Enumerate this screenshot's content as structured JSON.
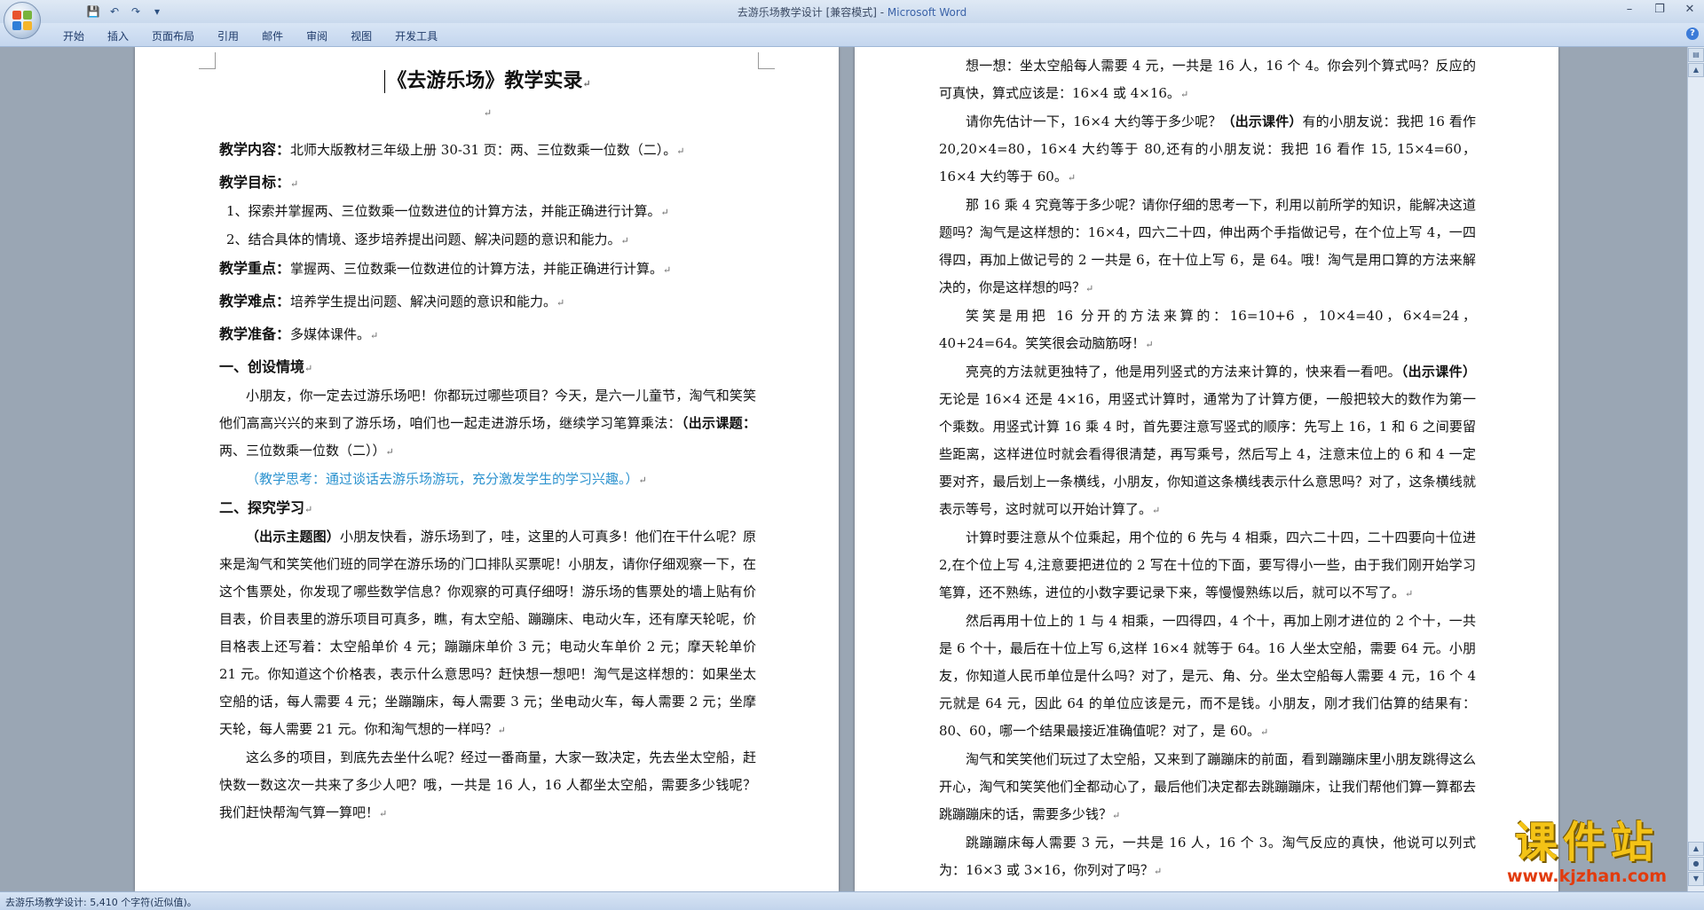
{
  "window": {
    "title": "去游乐场教学设计 [兼容模式] - ",
    "app": "Microsoft Word"
  },
  "qat": {
    "save": "💾",
    "undo": "↶",
    "redo": "↷",
    "more": "▾"
  },
  "ribbon_tabs": [
    "开始",
    "插入",
    "页面布局",
    "引用",
    "邮件",
    "审阅",
    "视图",
    "开发工具"
  ],
  "left_page": {
    "title": "《去游乐场》教学实录",
    "content_label": "教学内容：",
    "content_text": "北师大版教材三年级上册 30-31 页：两、三位数乘一位数（二）。",
    "goals_label": "教学目标：",
    "goals": [
      "1、探索并掌握两、三位数乘一位数进位的计算方法，并能正确进行计算。",
      "2、结合具体的情境、逐步培养提出问题、解决问题的意识和能力。"
    ],
    "key_label": "教学重点：",
    "key_text": "掌握两、三位数乘一位数进位的计算方法，并能正确进行计算。",
    "difficulty_label": "教学难点：",
    "difficulty_text": "培养学生提出问题、解决问题的意识和能力。",
    "prep_label": "教学准备：",
    "prep_text": "多媒体课件。",
    "section1": "一、创设情境",
    "s1_p1": "小朋友，你一定去过游乐场吧！你都玩过哪些项目？今天，是六一儿童节，淘气和笑笑他们高高兴兴的来到了游乐场，咱们也一起走进游乐场，继续学习笔算乘法：",
    "s1_p1_bold": "（出示课题：",
    "s1_p1_end": "两、三位数乘一位数（二））",
    "s1_note": "（教学思考：通过谈话去游乐场游玩，充分激发学生的学习兴趣。）",
    "section2": "二、探究学习",
    "s2_p1_bold": "（出示主题图）",
    "s2_p1": "小朋友快看，游乐场到了，哇，这里的人可真多！他们在干什么呢？原来是淘气和笑笑他们班的同学在游乐场的门口排队买票呢！小朋友，请你仔细观察一下，在这个售票处，你发现了哪些数学信息？你观察的可真仔细呀！游乐场的售票处的墙上贴有价目表，价目表里的游乐项目可真多，瞧，有太空船、蹦蹦床、电动火车，还有摩天轮呢，价目格表上还写着：太空船单价 4 元；蹦蹦床单价 3 元；电动火车单价 2 元；摩天轮单价 21 元。你知道这个价格表，表示什么意思吗？赶快想一想吧！淘气是这样想的：如果坐太空船的话，每人需要 4 元；坐蹦蹦床，每人需要 3 元；坐电动火车，每人需要 2 元；坐摩天轮，每人需要 21 元。你和淘气想的一样吗？",
    "s2_p2": "这么多的项目，到底先去坐什么呢？经过一番商量，大家一致决定，先去坐太空船，赶快数一数这次一共来了多少人吧？哦，一共是 16 人，16 人都坐太空船，需要多少钱呢？我们赶快帮淘气算一算吧！"
  },
  "right_page": {
    "p1": "想一想：坐太空船每人需要 4 元，一共是 16 人，16 个 4。你会列个算式吗？反应的可真快，算式应该是：16×4 或 4×16。",
    "p2a": "请你先估计一下，16×4 大约等于多少呢？",
    "p2b": "（出示课件）",
    "p2c": "有的小朋友说：我把 16 看作 20,20×4=80，16×4 大约等于 80,还有的小朋友说：我把 16 看作 15, 15×4=60，16×4 大约等于 60。",
    "p3": "那 16 乘 4 究竟等于多少呢？请你仔细的思考一下，利用以前所学的知识，能解决这道题吗？淘气是这样想的：16×4，四六二十四，伸出两个手指做记号，在个位上写 4，一四得四，再加上做记号的 2 一共是 6，在十位上写 6，是 64。哦！淘气是用口算的方法来解决的，你是这样想的吗？",
    "p4": "笑笑是用把 16 分开的方法来算的：16=10+6 ，10×4=40，6×4=24， 40+24=64。笑笑很会动脑筋呀！",
    "p5a": "亮亮的方法就更独特了，他是用列竖式的方法来计算的，快来看一看吧。",
    "p5b": "（出示课件）",
    "p5c": "无论是 16×4 还是 4×16，用竖式计算时，通常为了计算方便，一般把较大的数作为第一个乘数。用竖式计算 16 乘 4 时，首先要注意写竖式的顺序：先写上 16，1 和 6 之间要留些距离，这样进位时就会看得很清楚，再写乘号，然后写上 4，注意末位上的 6 和 4 一定要对齐，最后划上一条横线，小朋友，你知道这条横线表示什么意思吗？对了，这条横线就表示等号，这时就可以开始计算了。",
    "p6": "计算时要注意从个位乘起，用个位的 6 先与 4 相乘，四六二十四，二十四要向十位进 2,在个位上写 4,注意要把进位的 2 写在十位的下面，要写得小一些，由于我们刚开始学习笔算，还不熟练，进位的小数字要记录下来，等慢慢熟练以后，就可以不写了。",
    "p7": "然后再用十位上的 1 与 4 相乘，一四得四，4 个十，再加上刚才进位的 2 个十，一共是 6 个十，最后在十位上写 6,这样 16×4 就等于 64。16 人坐太空船，需要 64 元。小朋友，你知道人民币单位是什么吗？对了，是元、角、分。坐太空船每人需要 4 元，16 个 4 元就是 64 元，因此 64 的单位应该是元，而不是钱。小朋友，刚才我们估算的结果有：80、60，哪一个结果最接近准确值呢？对了，是 60。",
    "p8": "淘气和笑笑他们玩过了太空船，又来到了蹦蹦床的前面，看到蹦蹦床里小朋友跳得这么开心，淘气和笑笑他们全都动心了，最后他们决定都去跳蹦蹦床，让我们帮他们算一算都去跳蹦蹦床的话，需要多少钱？",
    "p9": "跳蹦蹦床每人需要 3 元，一共是 16 人，16 个 3。淘气反应的真快，他说可以列式为：16×3 或 3×16，你列对了吗？"
  },
  "para_mark": "↵",
  "status": "去游乐场教学设计: 5,410 个字符(近似值)。",
  "watermark": {
    "title": "课件站",
    "url": "www.kjzhan.com"
  },
  "colors": {
    "note_blue": "#2d93cf",
    "watermark_yellow": "#f4c316",
    "watermark_red": "#e23b0d"
  }
}
